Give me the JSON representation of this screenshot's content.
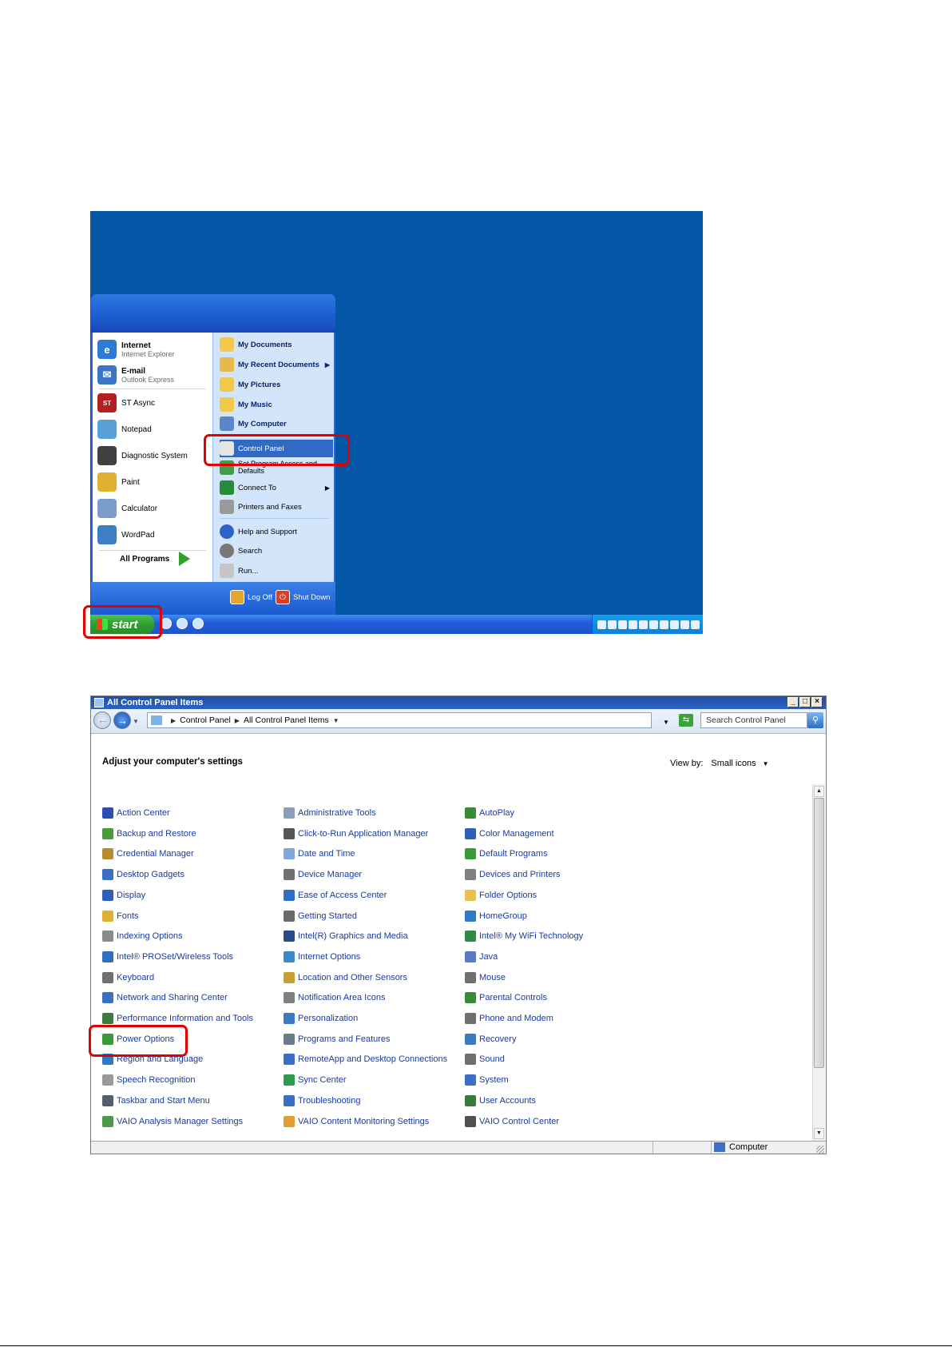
{
  "start_menu": {
    "pinned": [
      {
        "name": "Internet",
        "sub": "Internet Explorer",
        "icon": "internet-explorer-icon",
        "color": "#2e7bd6"
      },
      {
        "name": "E-mail",
        "sub": "Outlook Express",
        "icon": "outlook-express-icon",
        "color": "#3b74c9"
      }
    ],
    "recent": [
      {
        "label": "ST Async",
        "icon": "st-async-icon",
        "color": "#b02020"
      },
      {
        "label": "Notepad",
        "icon": "notepad-icon",
        "color": "#5aa0d8"
      },
      {
        "label": "Diagnostic System",
        "icon": "diagnostic-system-icon",
        "color": "#404040"
      },
      {
        "label": "Paint",
        "icon": "paint-icon",
        "color": "#e0b030"
      },
      {
        "label": "Calculator",
        "icon": "calculator-icon",
        "color": "#7a9cc8"
      },
      {
        "label": "WordPad",
        "icon": "wordpad-icon",
        "color": "#3c7fc5"
      }
    ],
    "all_programs": "All Programs",
    "right_items": [
      {
        "label": "My Documents",
        "bold": true,
        "icon": "folder-icon",
        "color": "#f2c94c"
      },
      {
        "label": "My Recent Documents",
        "bold": true,
        "arrow": true,
        "icon": "recent-documents-icon",
        "color": "#e7b84a"
      },
      {
        "label": "My Pictures",
        "bold": true,
        "icon": "pictures-folder-icon",
        "color": "#f0c84a"
      },
      {
        "label": "My Music",
        "bold": true,
        "icon": "music-folder-icon",
        "color": "#f0c84a"
      },
      {
        "label": "My Computer",
        "bold": true,
        "icon": "computer-icon",
        "color": "#5a86c9"
      },
      {
        "label": "Control Panel",
        "selected": true,
        "icon": "control-panel-icon",
        "color": "#e5e5e5"
      },
      {
        "label": "Set Program Access and Defaults",
        "icon": "program-access-icon",
        "color": "#3f9e4a"
      },
      {
        "label": "Connect To",
        "arrow": true,
        "icon": "connect-to-icon",
        "color": "#2a8a3c"
      },
      {
        "label": "Printers and Faxes",
        "icon": "printer-icon",
        "color": "#9a9a9a"
      },
      {
        "label": "Help and Support",
        "icon": "help-icon",
        "color": "#2f62c5"
      },
      {
        "label": "Search",
        "icon": "search-icon",
        "color": "#777777"
      },
      {
        "label": "Run...",
        "icon": "run-icon",
        "color": "#c5c5c5"
      }
    ],
    "log_off": "Log Off",
    "shut_down": "Shut Down"
  },
  "taskbar": {
    "start_label": "start"
  },
  "control_panel": {
    "title": "All Control Panel Items",
    "breadcrumb": [
      "Control Panel",
      "All Control Panel Items"
    ],
    "search_placeholder": "Search Control Panel",
    "heading": "Adjust your computer's settings",
    "view_by_label": "View by:",
    "view_by_value": "Small icons",
    "columns": [
      [
        {
          "label": "Action Center",
          "icon": "action-center-icon",
          "color": "#2a4fb0"
        },
        {
          "label": "Backup and Restore",
          "icon": "backup-icon",
          "color": "#4a9a3a"
        },
        {
          "label": "Credential Manager",
          "icon": "credential-icon",
          "color": "#b98a2f"
        },
        {
          "label": "Desktop Gadgets",
          "icon": "gadgets-icon",
          "color": "#3a6fc5"
        },
        {
          "label": "Display",
          "icon": "display-icon",
          "color": "#2f5fb8"
        },
        {
          "label": "Fonts",
          "icon": "fonts-icon",
          "color": "#e0b030"
        },
        {
          "label": "Indexing Options",
          "icon": "indexing-icon",
          "color": "#8a8a8a"
        },
        {
          "label": "Intel® PROSet/Wireless Tools",
          "icon": "wireless-icon",
          "color": "#2f6fc0"
        },
        {
          "label": "Keyboard",
          "icon": "keyboard-icon",
          "color": "#707070"
        },
        {
          "label": "Network and Sharing Center",
          "icon": "network-icon",
          "color": "#3a6fc5"
        },
        {
          "label": "Performance Information and Tools",
          "icon": "performance-icon",
          "color": "#3d7a3d"
        },
        {
          "label": "Power Options",
          "icon": "power-icon",
          "color": "#3a9a3a"
        },
        {
          "label": "Region and Language",
          "icon": "region-icon",
          "color": "#2f7ac5"
        },
        {
          "label": "Speech Recognition",
          "icon": "microphone-icon",
          "color": "#9a9a9a"
        },
        {
          "label": "Taskbar and Start Menu",
          "icon": "taskbar-icon",
          "color": "#506070"
        },
        {
          "label": "VAIO Analysis Manager Settings",
          "icon": "vaio-analysis-icon",
          "color": "#4a9a4a"
        }
      ],
      [
        {
          "label": "Administrative Tools",
          "icon": "admin-tools-icon",
          "color": "#8aa0b8"
        },
        {
          "label": "Click-to-Run Application Manager",
          "icon": "click-to-run-icon",
          "color": "#555555"
        },
        {
          "label": "Date and Time",
          "icon": "clock-icon",
          "color": "#7fa6d8"
        },
        {
          "label": "Device Manager",
          "icon": "device-manager-icon",
          "color": "#707070"
        },
        {
          "label": "Ease of Access Center",
          "icon": "ease-of-access-icon",
          "color": "#2f6fc5"
        },
        {
          "label": "Getting Started",
          "icon": "getting-started-icon",
          "color": "#6a6a6a"
        },
        {
          "label": "Intel(R) Graphics and Media",
          "icon": "intel-graphics-icon",
          "color": "#2a4a8a"
        },
        {
          "label": "Internet Options",
          "icon": "internet-options-icon",
          "color": "#3a8ac5"
        },
        {
          "label": "Location and Other Sensors",
          "icon": "location-icon",
          "color": "#c9a030"
        },
        {
          "label": "Notification Area Icons",
          "icon": "notification-icon",
          "color": "#808080"
        },
        {
          "label": "Personalization",
          "icon": "personalization-icon",
          "color": "#3a7ac0"
        },
        {
          "label": "Programs and Features",
          "icon": "programs-icon",
          "color": "#6a7a8a"
        },
        {
          "label": "RemoteApp and Desktop Connections",
          "icon": "remoteapp-icon",
          "color": "#3a6fc5"
        },
        {
          "label": "Sync Center",
          "icon": "sync-icon",
          "color": "#2f9a4a"
        },
        {
          "label": "Troubleshooting",
          "icon": "troubleshooting-icon",
          "color": "#3a6fc5"
        },
        {
          "label": "VAIO Content Monitoring Settings",
          "icon": "vaio-content-icon",
          "color": "#e0a030"
        }
      ],
      [
        {
          "label": "AutoPlay",
          "icon": "autoplay-icon",
          "color": "#3a8a3a"
        },
        {
          "label": "Color Management",
          "icon": "color-management-icon",
          "color": "#2f5fb8"
        },
        {
          "label": "Default Programs",
          "icon": "default-programs-icon",
          "color": "#3a9a3a"
        },
        {
          "label": "Devices and Printers",
          "icon": "printer-icon",
          "color": "#808080"
        },
        {
          "label": "Folder Options",
          "icon": "folder-options-icon",
          "color": "#e8c050"
        },
        {
          "label": "HomeGroup",
          "icon": "homegroup-icon",
          "color": "#2f7ac5"
        },
        {
          "label": "Intel® My WiFi Technology",
          "icon": "wifi-icon",
          "color": "#2f8a4a"
        },
        {
          "label": "Java",
          "icon": "java-icon",
          "color": "#5a7ac8"
        },
        {
          "label": "Mouse",
          "icon": "mouse-icon",
          "color": "#707070"
        },
        {
          "label": "Parental Controls",
          "icon": "parental-controls-icon",
          "color": "#3a8a3a"
        },
        {
          "label": "Phone and Modem",
          "icon": "phone-icon",
          "color": "#707070"
        },
        {
          "label": "Recovery",
          "icon": "recovery-icon",
          "color": "#3a7ac0"
        },
        {
          "label": "Sound",
          "icon": "sound-icon",
          "color": "#707070"
        },
        {
          "label": "System",
          "icon": "system-icon",
          "color": "#3a6fc5"
        },
        {
          "label": "User Accounts",
          "icon": "user-accounts-icon",
          "color": "#3a7a3a"
        },
        {
          "label": "VAIO Control Center",
          "icon": "vaio-control-icon",
          "color": "#505050"
        }
      ]
    ],
    "status_location": "Computer"
  }
}
